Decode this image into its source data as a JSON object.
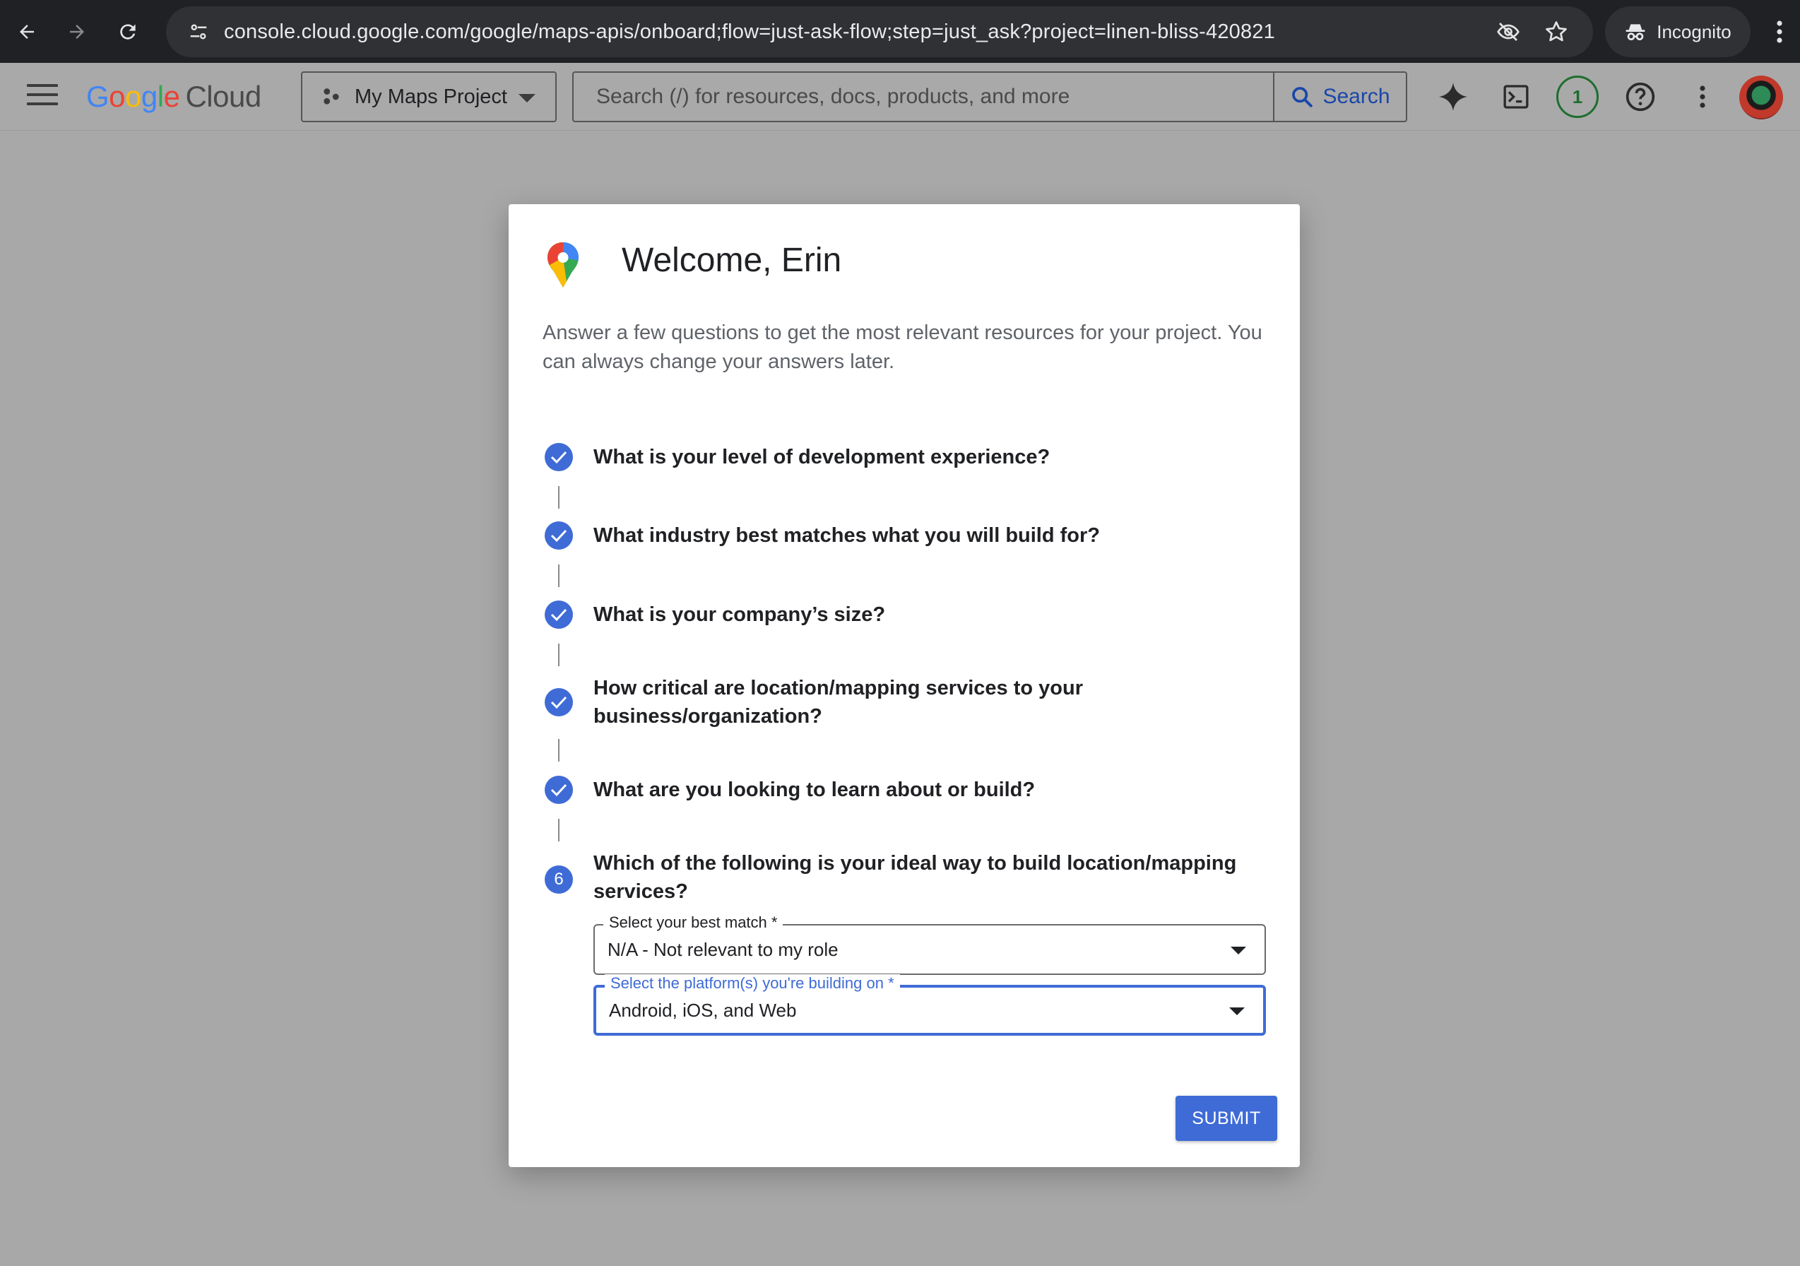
{
  "browser": {
    "url": "console.cloud.google.com/google/maps-apis/onboard;flow=just-ask-flow;step=just_ask?project=linen-bliss-420821",
    "incognito_label": "Incognito"
  },
  "header": {
    "logo": {
      "g1": "G",
      "o1": "o",
      "o2": "o",
      "g2": "g",
      "l": "l",
      "e": "e",
      "cloud": "Cloud"
    },
    "project_name": "My Maps Project",
    "search_placeholder": "Search (/) for resources, docs, products, and more",
    "search_button_label": "Search",
    "notification_count": "1"
  },
  "dialog": {
    "title": "Welcome, Erin",
    "intro": "Answer a few questions to get the most relevant resources for your project. You can always change your answers later.",
    "steps": [
      {
        "label": "What is your level of development experience?",
        "status": "complete"
      },
      {
        "label": "What industry best matches what you will build for?",
        "status": "complete"
      },
      {
        "label": "What is your company’s size?",
        "status": "complete"
      },
      {
        "label": "How critical are location/mapping services to your business/organization?",
        "status": "complete"
      },
      {
        "label": "What are you looking to learn about or build?",
        "status": "complete"
      },
      {
        "label": "Which of the following is your ideal way to build location/mapping services?",
        "status": "active",
        "number": "6"
      }
    ],
    "fields": {
      "best_match": {
        "label": "Select your best match *",
        "value": "N/A - Not relevant to my role"
      },
      "platforms": {
        "label": "Select the platform(s) you're building on *",
        "value": "Android, iOS, and Web"
      }
    },
    "submit_label": "SUBMIT"
  },
  "colors": {
    "accent": "#3f6bd6",
    "overlay": "#a8a8a8",
    "browser_chrome": "#1f2124"
  }
}
